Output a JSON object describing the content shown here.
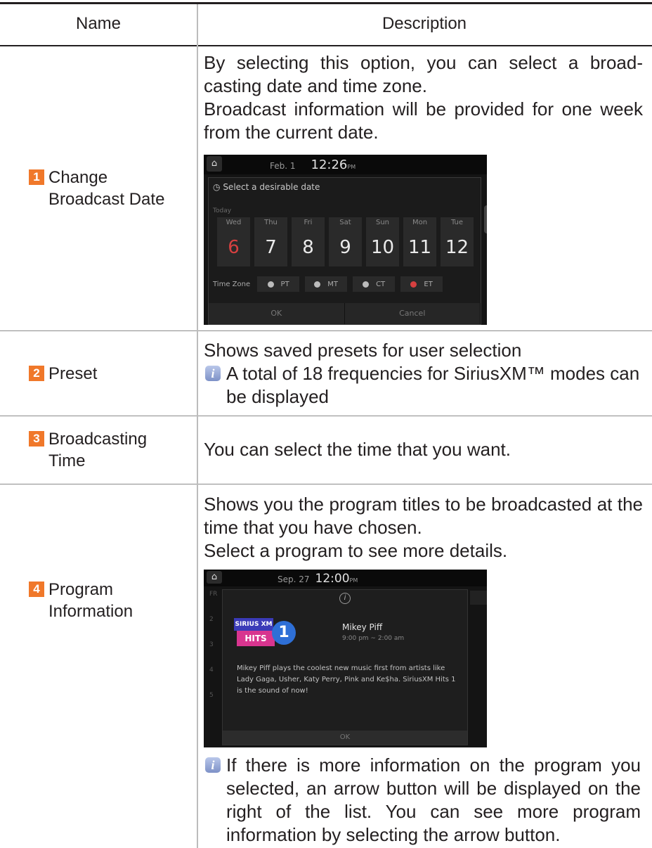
{
  "header": {
    "name": "Name",
    "description": "Description"
  },
  "rows": [
    {
      "number": "1",
      "name_lines": [
        "Change",
        "Broadcast Date"
      ],
      "paragraphs": [
        "By selecting this option, you can select a broad-casting date and time zone.",
        "Broadcast information will be provided for one week from the current date."
      ],
      "screen": {
        "date": "Feb. 1",
        "time": "12:26",
        "time_suffix": "PM",
        "title": "Select a desirable date",
        "today_label": "Today",
        "days": [
          {
            "name": "Wed",
            "date": "6",
            "selected": true
          },
          {
            "name": "Thu",
            "date": "7"
          },
          {
            "name": "Fri",
            "date": "8"
          },
          {
            "name": "Sat",
            "date": "9"
          },
          {
            "name": "Sun",
            "date": "10"
          },
          {
            "name": "Mon",
            "date": "11"
          },
          {
            "name": "Tue",
            "date": "12"
          }
        ],
        "time_zone_label": "Time Zone",
        "time_zones": [
          "PT",
          "MT",
          "CT",
          "ET"
        ],
        "selected_time_zone": "ET",
        "ok": "OK",
        "cancel": "Cancel"
      }
    },
    {
      "number": "2",
      "name_lines": [
        "Preset"
      ],
      "paragraphs": [
        "Shows saved presets for user selection"
      ],
      "note": "A total of 18 frequencies for SiriusXM™ modes can be displayed"
    },
    {
      "number": "3",
      "name_lines": [
        "Broadcasting",
        "Time"
      ],
      "paragraphs": [
        "You can select the time that you want."
      ]
    },
    {
      "number": "4",
      "name_lines": [
        "Program",
        "Information"
      ],
      "paragraphs": [
        "Shows you the program titles to be broadcasted at the time that you have chosen.",
        "Select a program to see more details."
      ],
      "screen": {
        "date": "Sep. 27",
        "time": "12:00",
        "time_suffix": "PM",
        "logo_top": "SIRIUS XM",
        "logo_bottom": "HITS",
        "logo_number": "1",
        "program_title": "Mikey Piff",
        "program_time": "9:00 pm ~ 2:00 am",
        "program_description": "Mikey Piff plays the coolest new music first from artists like Lady Gaga, Usher, Katy Perry, Pink and Ke$ha. SiriusXM Hits 1 is the sound of now!",
        "side_labels": [
          "FR",
          "2",
          "3",
          "4",
          "5"
        ],
        "ok": "OK"
      },
      "note": "If there is more information on the program you selected, an arrow button will be displayed on the right of the list. You can see more program information by selecting the arrow button."
    }
  ],
  "colors": {
    "number_badge": "#f0782a",
    "info_icon": "#8da0d4",
    "rule": "#231f20",
    "divider": "#bcbcbc"
  }
}
